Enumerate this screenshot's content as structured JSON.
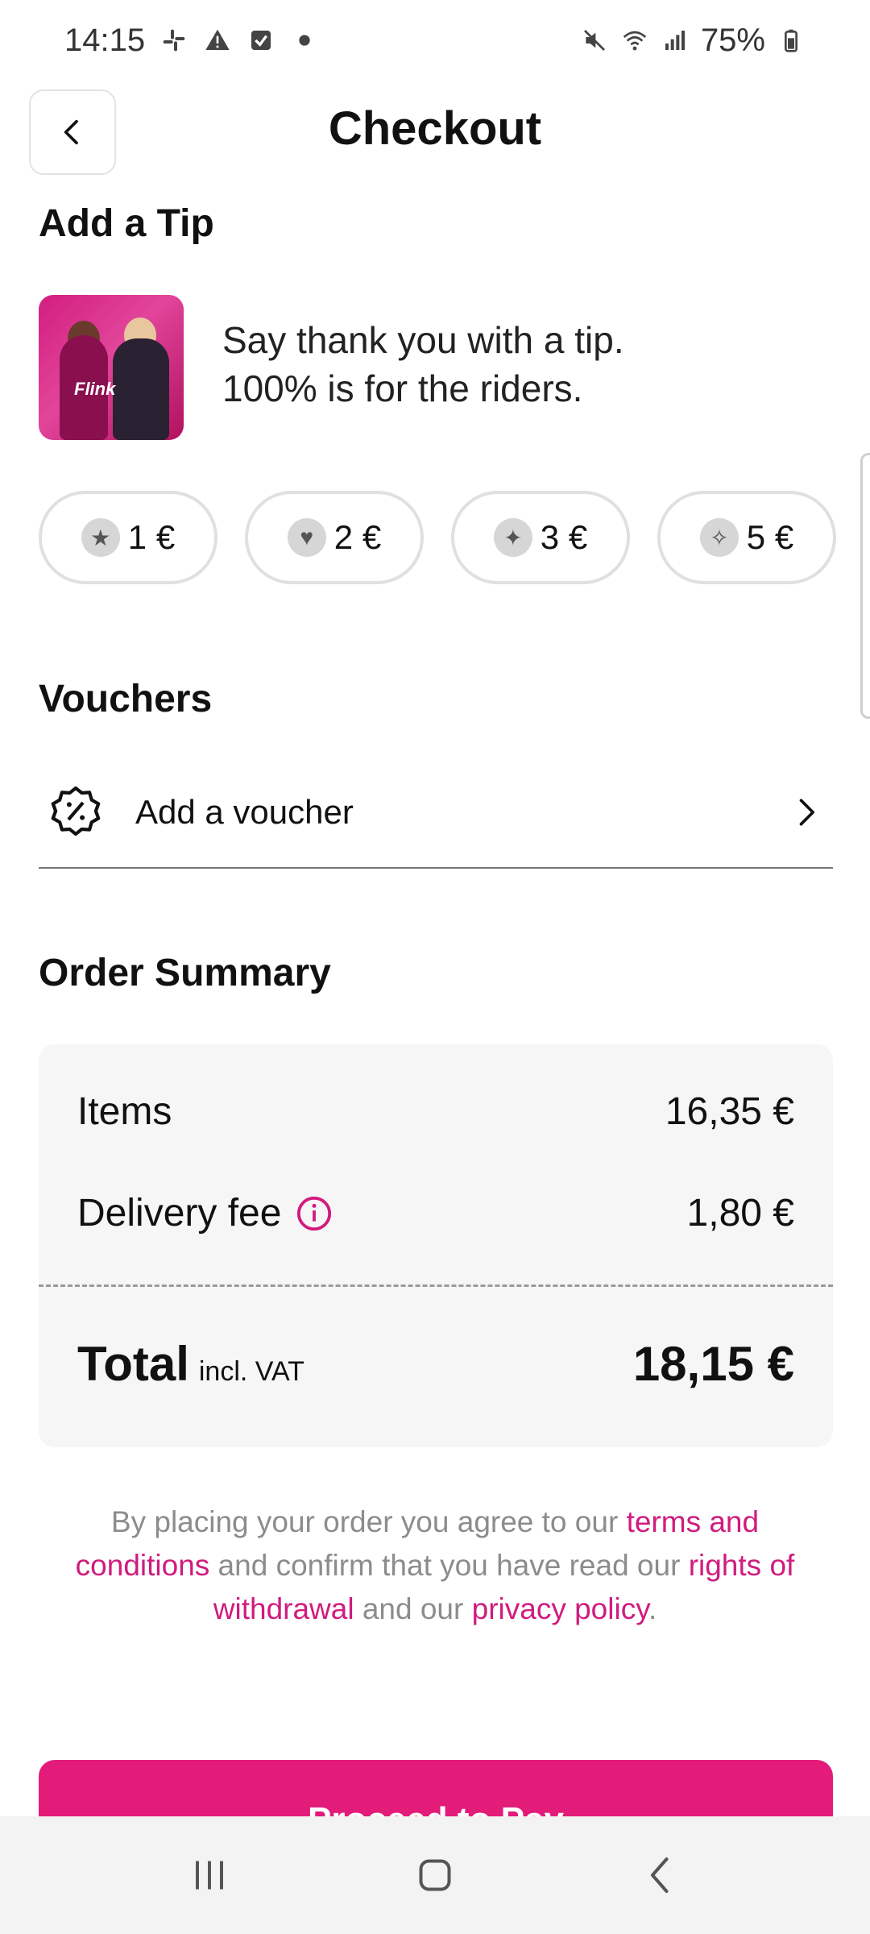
{
  "status_bar": {
    "time": "14:15",
    "battery": "75%",
    "left_icons": [
      "slack-icon",
      "warning-icon",
      "checkbox-icon",
      "dot-icon"
    ],
    "right_icons": [
      "mute-icon",
      "wifi-icon",
      "signal-icon",
      "battery-icon"
    ]
  },
  "header": {
    "title": "Checkout",
    "back_icon": "chevron-left-icon"
  },
  "tip": {
    "title": "Add a Tip",
    "image_brand": "Flink",
    "text_line1": "Say thank you with a tip.",
    "text_line2": "100% is for the riders.",
    "options": [
      {
        "emoji": "star-struck-emoji",
        "glyph": "★",
        "label": "1 €"
      },
      {
        "emoji": "heart-eyes-emoji",
        "glyph": "♥",
        "label": "2 €"
      },
      {
        "emoji": "party-face-emoji",
        "glyph": "✦",
        "label": "3 €"
      },
      {
        "emoji": "party-popper-emoji",
        "glyph": "✧",
        "label": "5 €"
      }
    ]
  },
  "vouchers": {
    "title": "Vouchers",
    "add_label": "Add a voucher",
    "icon": "discount-badge-icon"
  },
  "summary": {
    "title": "Order Summary",
    "items_label": "Items",
    "items_value": "16,35 €",
    "delivery_label": "Delivery fee",
    "delivery_value": "1,80 €",
    "total_label": "Total",
    "total_sub": "incl. VAT",
    "total_value": "18,15 €"
  },
  "legal": {
    "part1": "By placing your order you agree to our ",
    "link1": "terms and conditions",
    "part2": " and confirm that you have read our ",
    "link2": "rights of withdrawal",
    "part3": " and our ",
    "link3": "privacy policy",
    "part4": "."
  },
  "cta": {
    "label": "Proceed to Pay"
  },
  "colors": {
    "accent": "#e31c79",
    "link": "#d01b7f",
    "card_bg": "#f6f6f6"
  }
}
